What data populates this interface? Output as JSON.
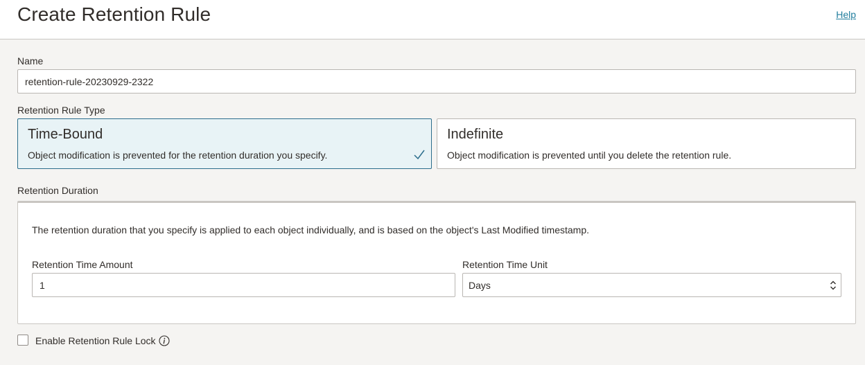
{
  "header": {
    "title": "Create Retention Rule",
    "help_label": "Help"
  },
  "name_field": {
    "label": "Name",
    "value": "retention-rule-20230929-2322"
  },
  "rule_type": {
    "label": "Retention Rule Type",
    "options": [
      {
        "title": "Time-Bound",
        "description": "Object modification is prevented for the retention duration you specify.",
        "selected": true
      },
      {
        "title": "Indefinite",
        "description": "Object modification is prevented until you delete the retention rule.",
        "selected": false
      }
    ]
  },
  "retention_duration": {
    "label": "Retention Duration",
    "description": "The retention duration that you specify is applied to each object individually, and is based on the object's Last Modified timestamp.",
    "amount_label": "Retention Time Amount",
    "amount_value": "1",
    "unit_label": "Retention Time Unit",
    "unit_value": "Days"
  },
  "rule_lock": {
    "label": "Enable Retention Rule Lock",
    "checked": false
  },
  "colors": {
    "accent": "#2b6d8c",
    "link": "#227e9e",
    "selected_card_bg": "#e8f3f6",
    "page_bg": "#f5f4f2"
  }
}
